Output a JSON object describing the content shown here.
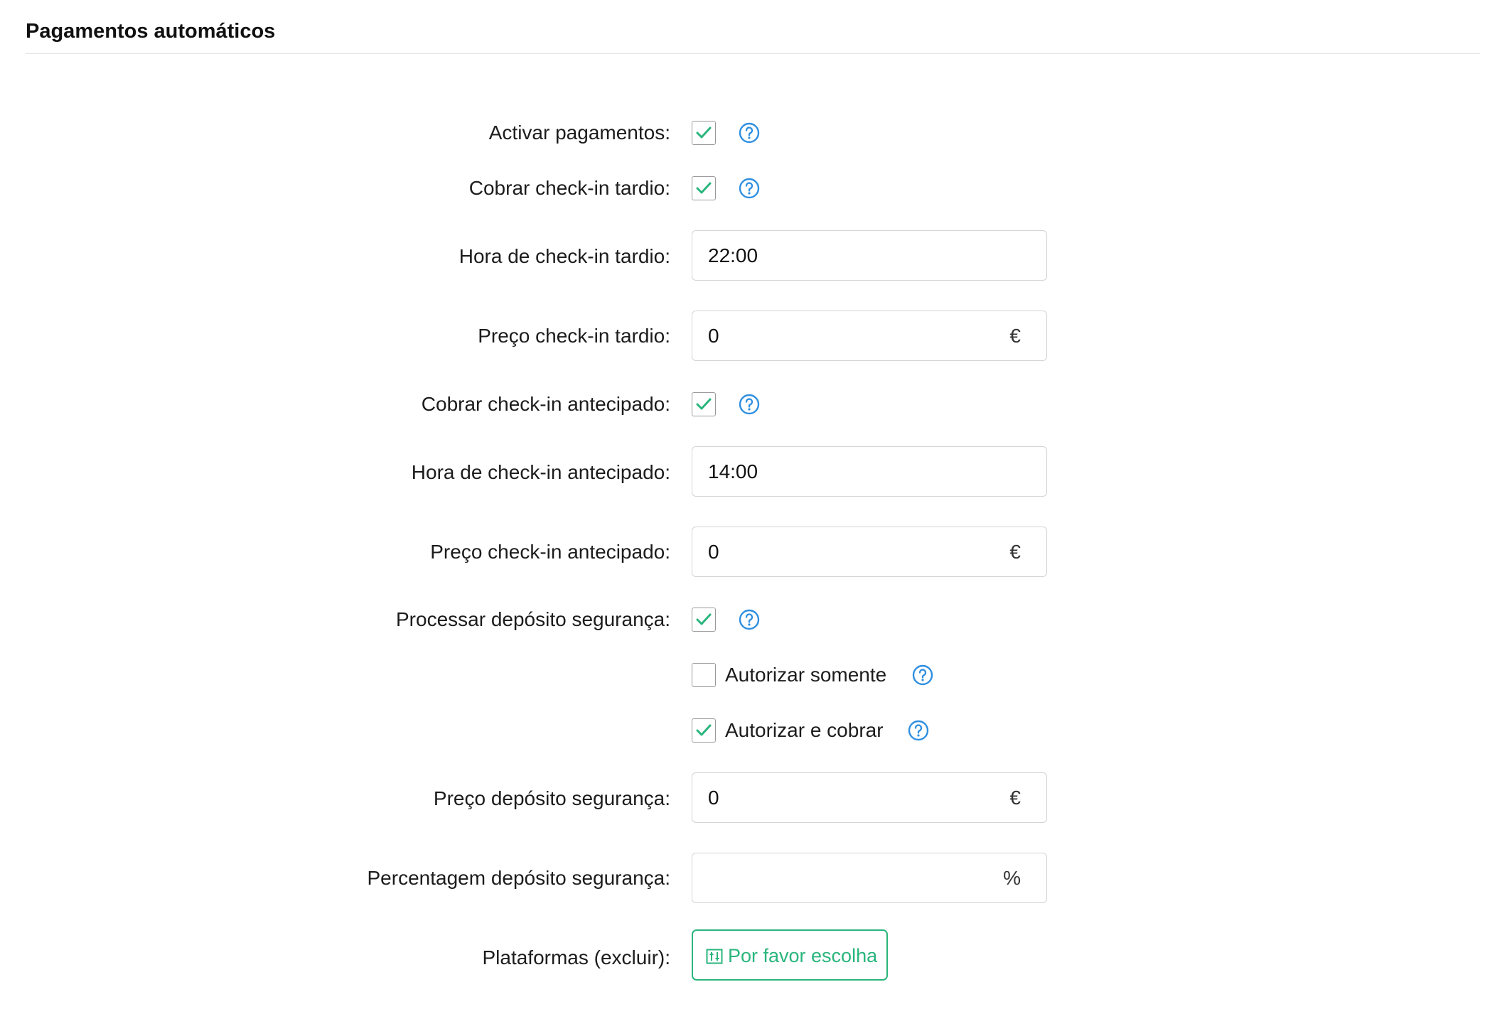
{
  "section": {
    "title": "Pagamentos automáticos"
  },
  "colors": {
    "accent_green": "#2ab57d",
    "help_blue": "#2f8fe0",
    "border": "#d4d4d4"
  },
  "icons": {
    "help": "question-circle-icon",
    "check": "check-icon",
    "button": "filter-list-icon"
  },
  "fields": {
    "activate_payments": {
      "label": "Activar pagamentos:",
      "checked": true
    },
    "charge_late_checkin": {
      "label": "Cobrar check-in tardio:",
      "checked": true
    },
    "late_checkin_time": {
      "label": "Hora de check-in tardio:",
      "value": "22:00"
    },
    "late_checkin_price": {
      "label": "Preço check-in tardio:",
      "value": "0",
      "suffix": "€"
    },
    "charge_early_checkin": {
      "label": "Cobrar check-in antecipado:",
      "checked": true
    },
    "early_checkin_time": {
      "label": "Hora de check-in antecipado:",
      "value": "14:00"
    },
    "early_checkin_price": {
      "label": "Preço check-in antecipado:",
      "value": "0",
      "suffix": "€"
    },
    "process_deposit": {
      "label": "Processar depósito segurança:",
      "checked": true
    },
    "authorize_only": {
      "label": "Autorizar somente",
      "checked": false
    },
    "authorize_and_charge": {
      "label": "Autorizar e cobrar",
      "checked": true
    },
    "deposit_price": {
      "label": "Preço depósito segurança:",
      "value": "0",
      "suffix": "€"
    },
    "deposit_percentage": {
      "label": "Percentagem depósito segurança:",
      "value": "",
      "suffix": "%"
    },
    "platforms_exclude": {
      "label": "Plataformas (excluir):",
      "button_label": "Por favor escolha"
    }
  }
}
